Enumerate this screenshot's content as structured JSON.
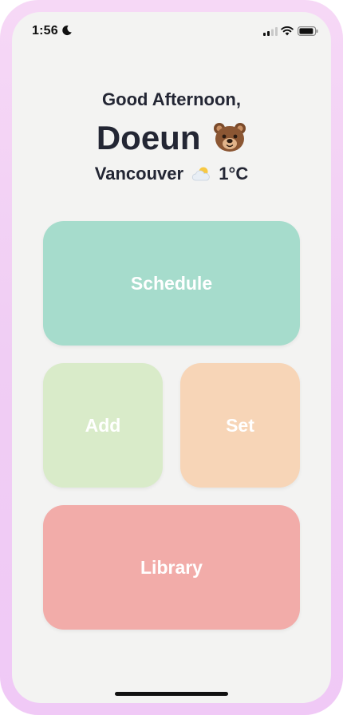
{
  "status_bar": {
    "time": "1:56",
    "icons": [
      "moon-icon",
      "signal-icon",
      "wifi-icon",
      "battery-icon"
    ]
  },
  "header": {
    "greeting": "Good Afternoon,",
    "name": "Doeun",
    "name_icon": "bear-face-icon",
    "city": "Vancouver",
    "weather_icon": "sun-behind-cloud-icon",
    "temperature": "1°C"
  },
  "tiles": {
    "schedule": {
      "label": "Schedule",
      "color": "#a6dccc"
    },
    "add": {
      "label": "Add",
      "color": "#d9ebc9"
    },
    "set": {
      "label": "Set",
      "color": "#f7d5b7"
    },
    "library": {
      "label": "Library",
      "color": "#f2aca9"
    }
  },
  "theme": {
    "frame_color": "#f2cff5",
    "screen_background": "#f3f3f2",
    "text_color": "#232634"
  }
}
